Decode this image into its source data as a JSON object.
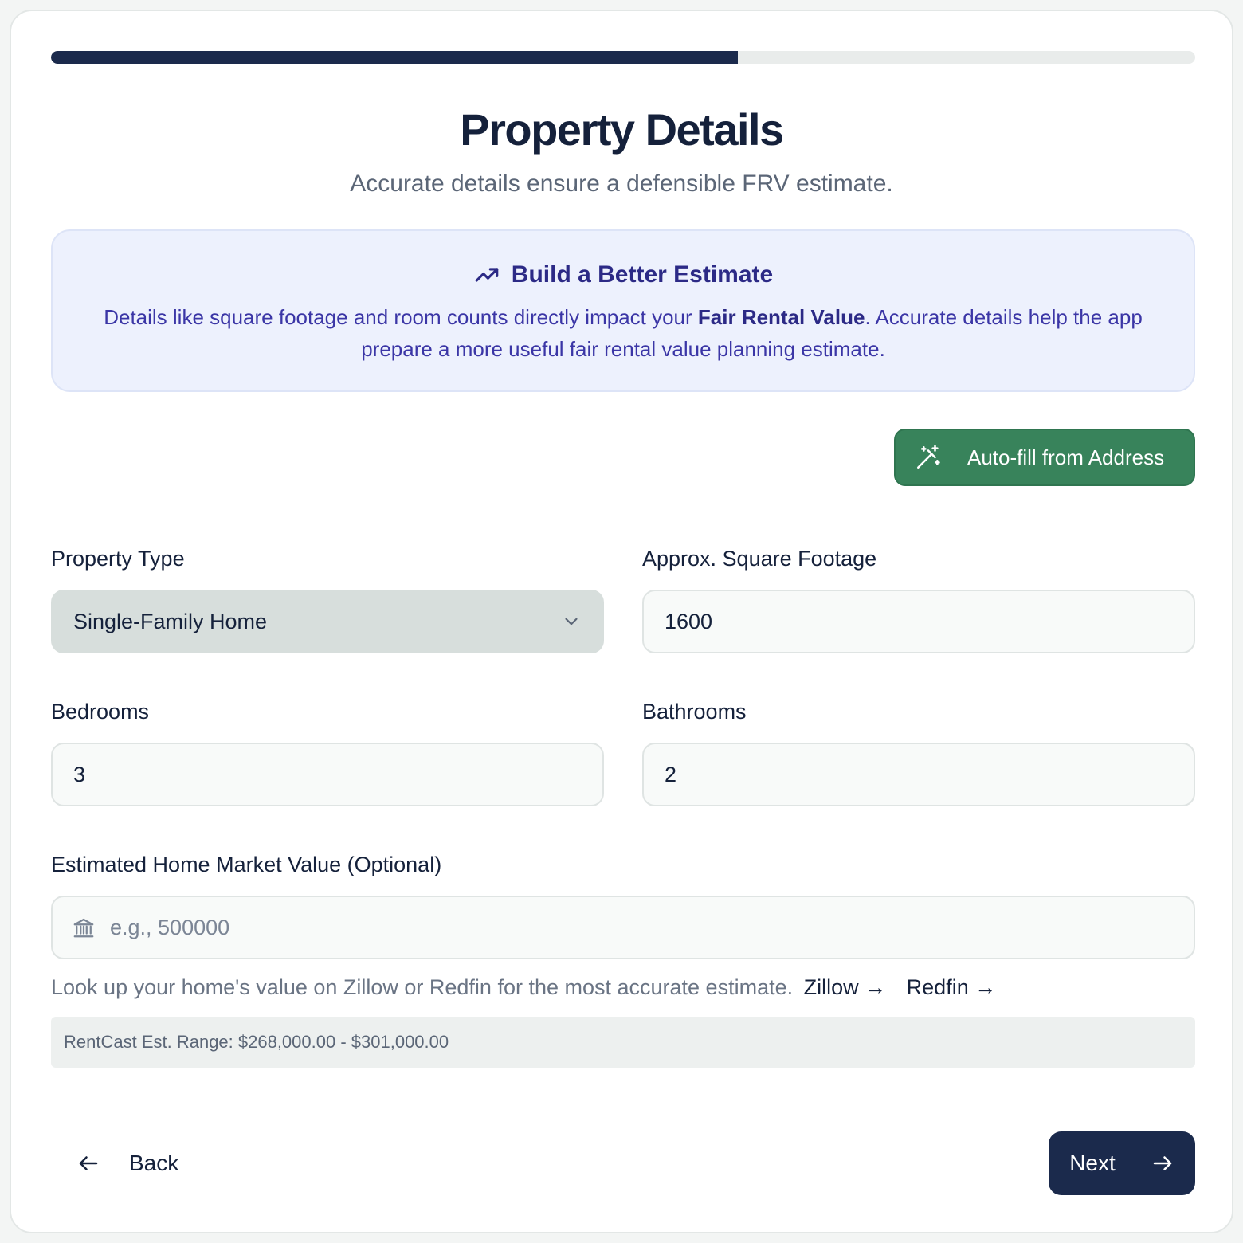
{
  "progress": {
    "fraction": 0.6
  },
  "header": {
    "title": "Property Details",
    "subtitle": "Accurate details ensure a defensible FRV estimate."
  },
  "info": {
    "icon": "trending-up-icon",
    "heading": "Build a Better Estimate",
    "body_before": "Details like square footage and room counts directly impact your ",
    "body_bold": "Fair Rental Value",
    "body_after": ". Accurate details help the app prepare a more useful fair rental value planning estimate."
  },
  "autofill": {
    "icon": "magic-wand-icon",
    "label": "Auto-fill from Address"
  },
  "form": {
    "property_type": {
      "label": "Property Type",
      "value": "Single-Family Home"
    },
    "square_footage": {
      "label": "Approx. Square Footage",
      "value": "1600"
    },
    "bedrooms": {
      "label": "Bedrooms",
      "value": "3"
    },
    "bathrooms": {
      "label": "Bathrooms",
      "value": "2"
    },
    "market_value": {
      "label": "Estimated Home Market Value (Optional)",
      "value": "",
      "placeholder": "e.g., 500000",
      "icon": "bank-icon"
    }
  },
  "hint": {
    "text": "Look up your home's value on Zillow or Redfin for the most accurate estimate.",
    "zillow": "Zillow",
    "redfin": "Redfin"
  },
  "range": {
    "text": "RentCast Est. Range: $268,000.00 - $301,000.00"
  },
  "nav": {
    "back_label": "Back",
    "next_label": "Next"
  },
  "colors": {
    "primary": "#1b2a4c",
    "success": "#38835b",
    "info_bg": "#edf1fd",
    "info_text": "#3a35a0"
  }
}
